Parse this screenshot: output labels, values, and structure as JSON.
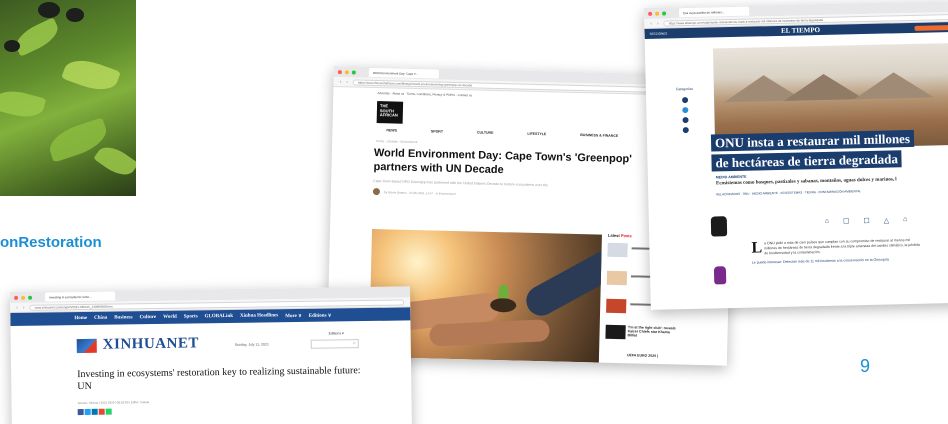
{
  "slide": {
    "hashtag": "onRestoration",
    "page_number": "9"
  },
  "colors": {
    "accent_blue": "#1a8fd6",
    "el_tiempo_navy": "#1b3d6e",
    "xinhua_blue": "#1f4e93"
  },
  "south_african": {
    "tab_title": "World Environment Day: Cape T...",
    "url": "https://www.thesouthafrican.com/lifestyle/world-environment-day-greenpop-un-decade",
    "top_links": "Advertise · About us · Terms, Conditions, Privacy & POPIA · Contact us",
    "logo_lines": [
      "THE",
      "SOUTH",
      "AFRICAN"
    ],
    "menu": [
      "NEWS",
      "SPORT",
      "CULTURE",
      "LIFESTYLE",
      "BUSINESS & FINANCE",
      "SAFTOURISTLIFE"
    ],
    "breadcrumb": "Home › Lifestyle › Environment",
    "headline": "World Environment Day: Cape Town's 'Greenpop' partners with UN Decade",
    "subhead": "Cape Town-based NPO Greenpop has partnered with the United Nations Decade to restore ecosystems over the",
    "byline": "by Nicole Batters · 04-06-2021 14:47 · in Environment",
    "latest_label": "Latest",
    "latest_highlight": "Posts",
    "quote": "'I'm at the right club': reveals Kaizer Chiefs star Khama Billiat",
    "euro": "UEFA EURO 2020 |"
  },
  "el_tiempo": {
    "tab_title": "Ese cuya auxiliar de millones...",
    "url": "https://www.eltiempo.com/vida/medio-ambiente/onu-insta-a-restaurar-mil-millones-de-hectareas-de-tierra-degradada",
    "section": "SECCIONES",
    "brand": "EL TIEMPO",
    "headline_line1": "ONU insta a restaurar mil millones",
    "headline_line2": "de hectáreas de tierra degradada",
    "categories": "Categorías",
    "kicker_label": "MEDIO AMBIENTE",
    "kicker": "Ecosistemas como bosques, pastizales y sabanas, montañas, aguas dulces y marinos, l",
    "tags": "RELACIONADOS · ONU · MEDIO AMBIENTE · ECOSISTEMAS · TIERRA · CONTAMINACIÓN AMBIENTAL",
    "icons": [
      "⌂",
      "☐",
      "☐",
      "△",
      "⌂"
    ],
    "dropcap": "L",
    "body": "a ONU pidió a más de cien países que cumplan con su compromiso de restaurar al menos mil millones de hectáreas de tierra degradada frente a la triple amenaza del cambio climático, la pérdida de biodiversidad y la contaminación.",
    "body_link": "Le puede interesar: Detectan más de 11 mil hectáreas a la conservación en la Orinoquía"
  },
  "xinhua": {
    "tab_title": "Investing in ecosystems' resto...",
    "url": "www.xinhuanet.com/english/2021-06/04/c_139989398.htm",
    "nav": [
      "Home",
      "China",
      "Business",
      "Culture",
      "World",
      "Sports",
      "GLOBALink",
      "Xinhua Headlines",
      "More ∨",
      "Editions ∨"
    ],
    "brand": "XINHUANET",
    "date": "Sunday, July 11, 2021",
    "editions": "Editions ▾",
    "search_icon": "⌕",
    "headline": "Investing in ecosystems' restoration key to realizing sustainable future: UN",
    "source": "Source: Xinhua | 2021-06-04 06:18:00 | Editor: huaxia"
  }
}
